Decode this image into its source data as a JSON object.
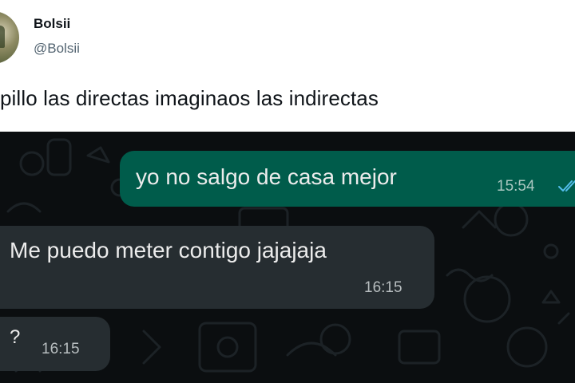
{
  "tweet": {
    "display_name": "Bolsii",
    "handle": "@Bolsii",
    "text": "pillo las directas imaginaos las indirectas"
  },
  "chat": {
    "messages": [
      {
        "direction": "outgoing",
        "text": "yo no salgo de casa mejor",
        "time": "15:54",
        "status_icon": "double-check-read-icon"
      },
      {
        "direction": "incoming",
        "text": "Me puedo meter contigo jajajaja",
        "time": "16:15"
      },
      {
        "direction": "incoming",
        "text": "?",
        "time": "16:15"
      }
    ]
  },
  "colors": {
    "chat_background": "#0b0e10",
    "outgoing_bubble": "#005c4b",
    "incoming_bubble": "#262d31",
    "read_ticks": "#53bdeb"
  }
}
